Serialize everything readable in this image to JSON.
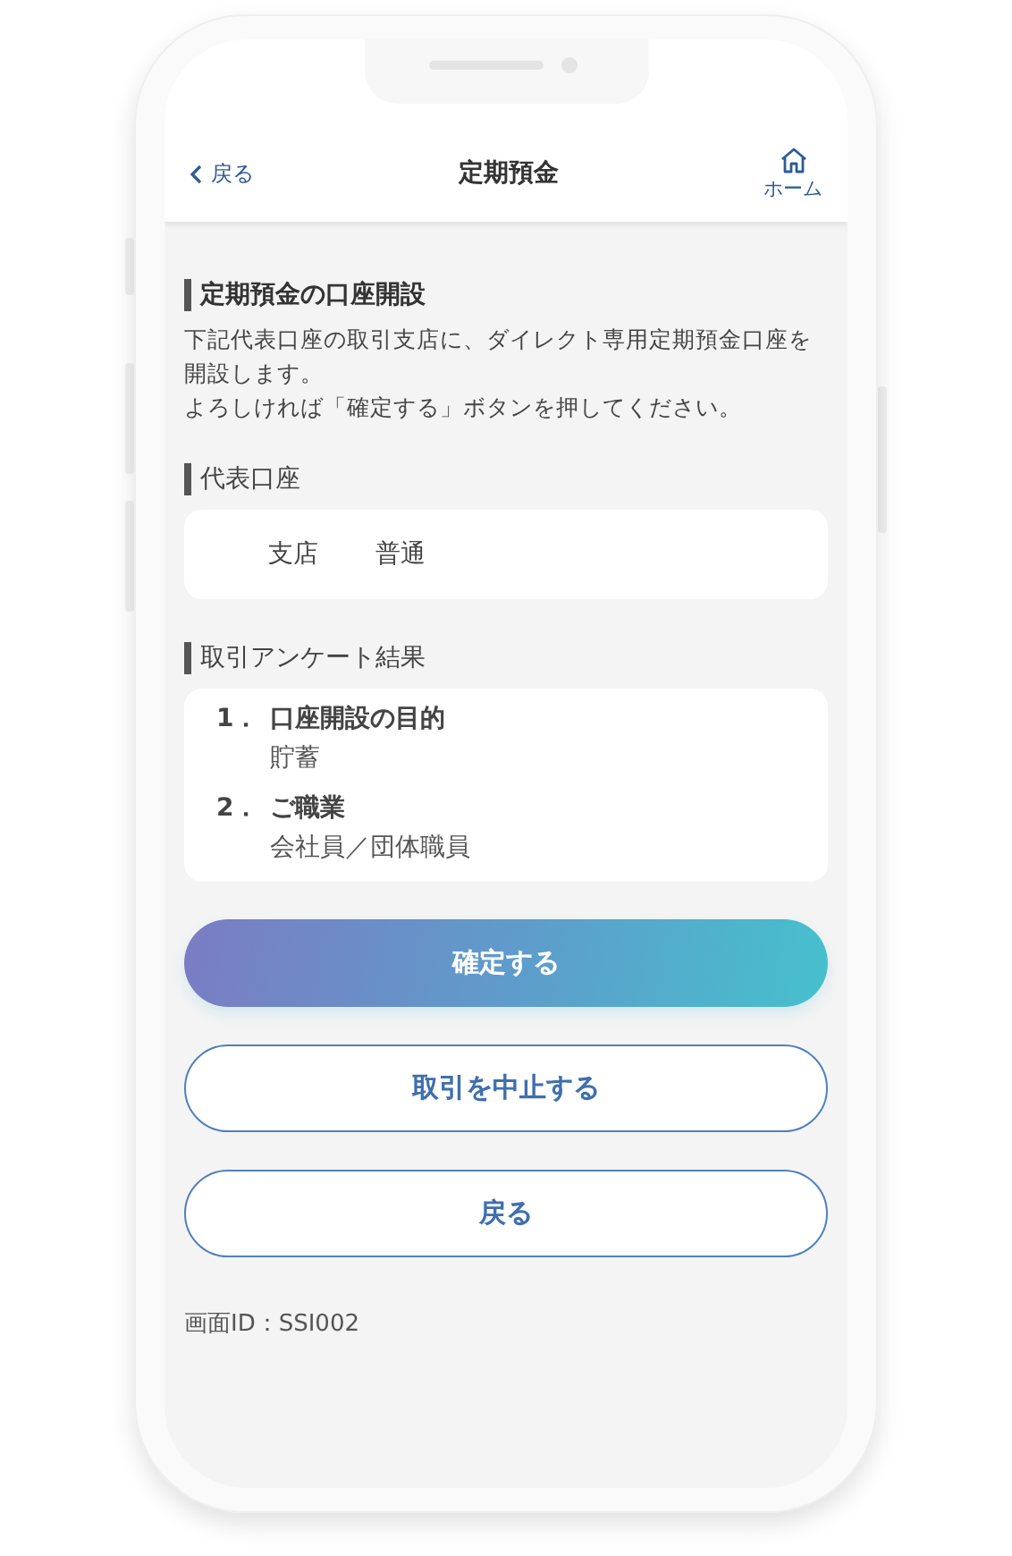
{
  "header": {
    "back": "戻る",
    "title": "定期預金",
    "home": "ホーム"
  },
  "intro": {
    "heading": "定期預金の口座開設",
    "paragraphs": [
      "下記代表口座の取引支店に、ダイレクト専用定期預金口座を開設します。",
      "よろしければ「確定する」ボタンを押してください。"
    ]
  },
  "account": {
    "heading": "代表口座",
    "branch": "支店",
    "type": "普通"
  },
  "survey": {
    "heading": "取引アンケート結果",
    "items": [
      {
        "number": "1．",
        "question": "口座開設の目的",
        "answer": "貯蓄"
      },
      {
        "number": "2．",
        "question": "ご職業",
        "answer": "会社員／団体職員"
      }
    ]
  },
  "buttons": [
    {
      "label": "確定する",
      "kind": "primary"
    },
    {
      "label": "取引を中止する",
      "kind": "outline"
    },
    {
      "label": "戻る",
      "kind": "outline"
    }
  ],
  "screen_id": "画面ID：SSI002"
}
